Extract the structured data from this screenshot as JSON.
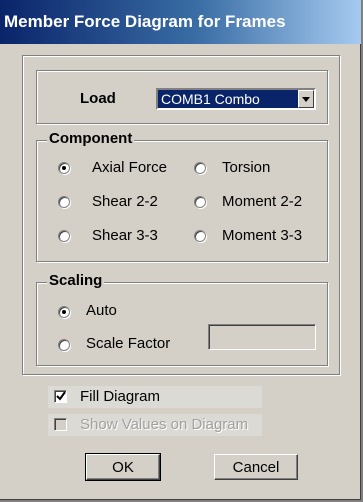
{
  "window": {
    "title": "Member Force Diagram for Frames"
  },
  "load": {
    "label": "Load",
    "selected": "COMB1 Combo"
  },
  "component": {
    "title": "Component",
    "options": [
      {
        "label": "Axial Force",
        "selected": true
      },
      {
        "label": "Torsion",
        "selected": false
      },
      {
        "label": "Shear 2-2",
        "selected": false
      },
      {
        "label": "Moment 2-2",
        "selected": false
      },
      {
        "label": "Shear 3-3",
        "selected": false
      },
      {
        "label": "Moment 3-3",
        "selected": false
      }
    ]
  },
  "scaling": {
    "title": "Scaling",
    "options": [
      {
        "label": "Auto",
        "selected": true
      },
      {
        "label": "Scale Factor",
        "selected": false
      }
    ],
    "scale_factor_value": ""
  },
  "options": {
    "fill_diagram": {
      "label": "Fill Diagram",
      "checked": true,
      "enabled": true
    },
    "show_values": {
      "label": "Show Values on Diagram",
      "checked": false,
      "enabled": false
    }
  },
  "buttons": {
    "ok": "OK",
    "cancel": "Cancel"
  },
  "icons": {
    "dropdown": "chevron-down-icon",
    "check": "check-icon"
  }
}
